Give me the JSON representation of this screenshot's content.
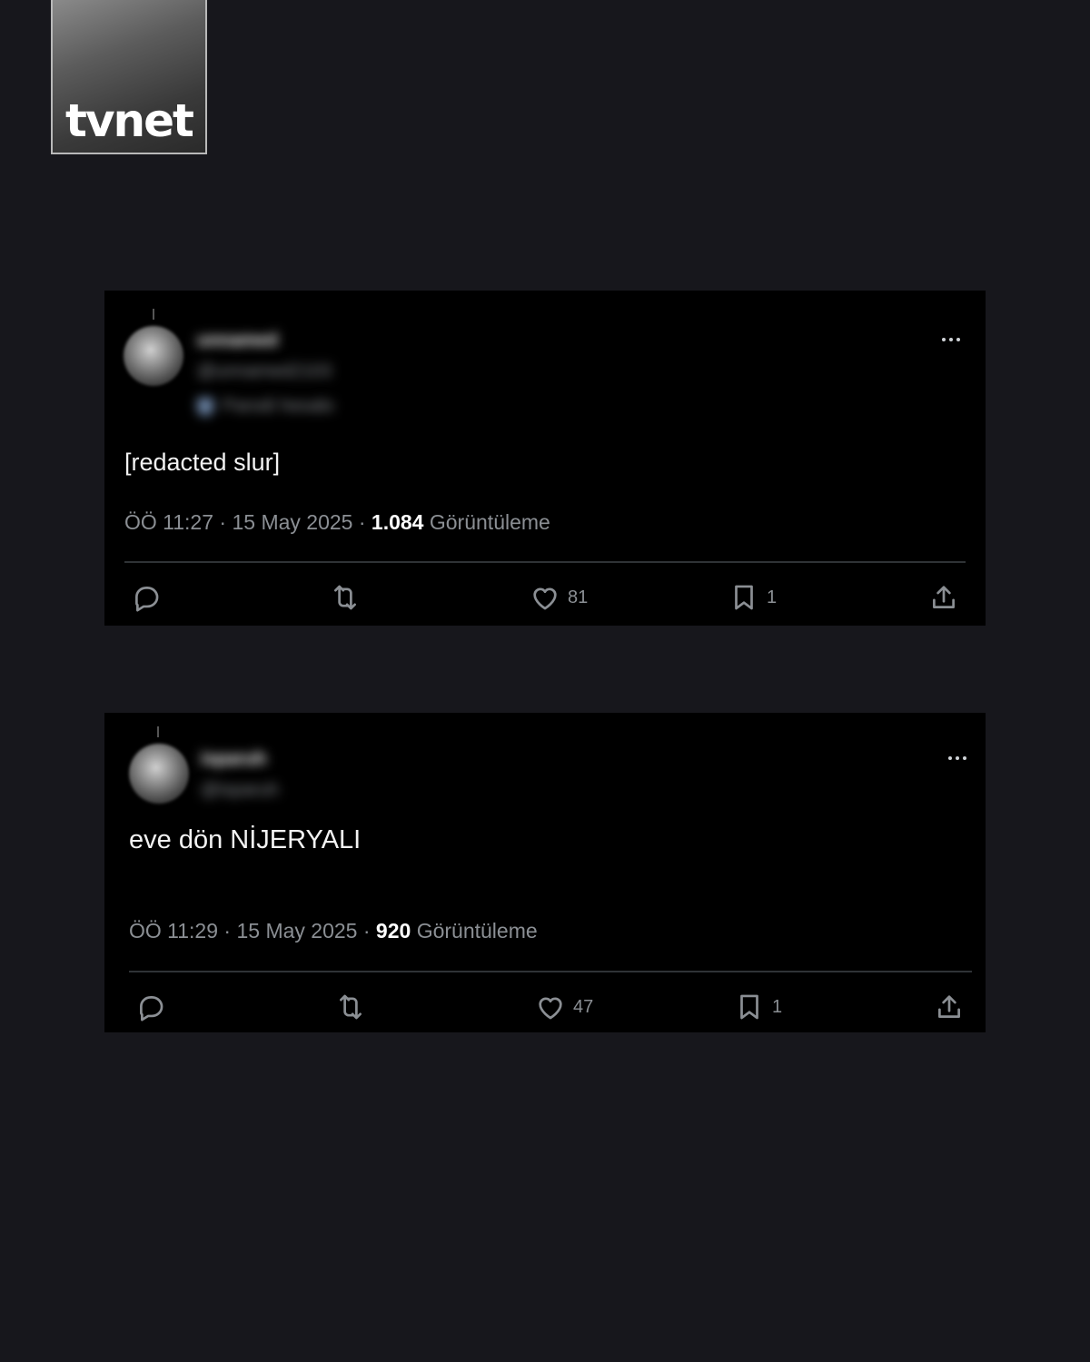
{
  "logo": {
    "text": "tvnet"
  },
  "tweets": [
    {
      "display_name": "unnamed",
      "handle": "@unnamed2103",
      "label": "Parodi hesabı",
      "text": "[redacted slur]",
      "time": "ÖÖ 11:27",
      "date": "15 May 2025",
      "views": "1.084",
      "views_label": "Görüntüleme",
      "likes": "81",
      "bookmarks": "1"
    },
    {
      "display_name": "isparuh",
      "handle": "@isparuh",
      "text": "eve dön NİJERYALI",
      "time": "ÖÖ 11:29",
      "date": "15 May 2025",
      "views": "920",
      "views_label": "Görüntüleme",
      "likes": "47",
      "bookmarks": "1"
    }
  ],
  "icons": [
    "reply-icon",
    "retweet-icon",
    "like-icon",
    "bookmark-icon",
    "share-icon",
    "more-icon"
  ],
  "colors": {
    "page_bg": "#17171c",
    "card_bg": "#000000",
    "muted_text": "#8b8f94"
  }
}
